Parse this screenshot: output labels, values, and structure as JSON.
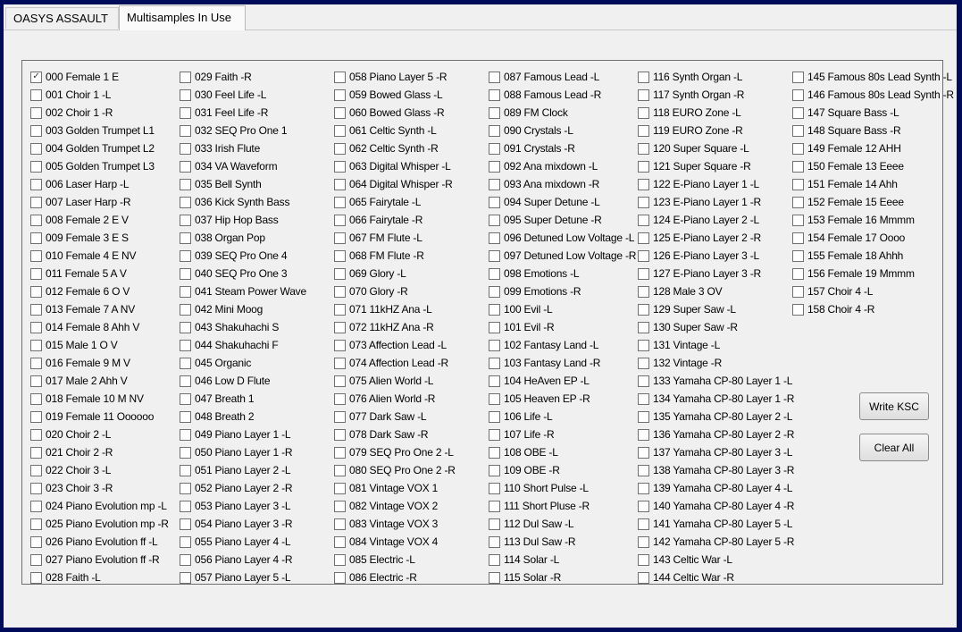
{
  "tabs": [
    "OASYS ASSAULT",
    "Multisamples In Use"
  ],
  "buttons": {
    "write": "Write KSC",
    "clear": "Clear All"
  },
  "columns": [
    [
      "000 Female 1 E",
      "001 Choir 1 -L",
      "002 Choir 1 -R",
      "003 Golden Trumpet L1",
      "004 Golden Trumpet L2",
      "005 Golden Trumpet L3",
      "006 Laser Harp -L",
      "007 Laser Harp -R",
      "008 Female 2 E V",
      "009 Female 3 E S",
      "010 Female 4 E NV",
      "011 Female 5 A V",
      "012 Female 6 O V",
      "013 Female 7 A NV",
      "014 Female 8 Ahh V",
      "015 Male 1 O V",
      "016 Female 9 M V",
      "017 Male 2 Ahh V",
      "018 Female 10 M NV",
      "019 Female 11 Oooooo",
      "020 Choir 2 -L",
      "021 Choir 2 -R",
      "022 Choir 3 -L",
      "023 Choir 3 -R",
      "024 Piano Evolution mp -L",
      "025 Piano Evolution mp -R",
      "026 Piano Evolution ff -L",
      "027 Piano Evolution ff -R",
      "028 Faith -L"
    ],
    [
      "029 Faith -R",
      "030 Feel Life -L",
      "031 Feel Life -R",
      "032 SEQ Pro One 1",
      "033 Irish Flute",
      "034 VA Waveform",
      "035 Bell Synth",
      "036 Kick Synth Bass",
      "037 Hip Hop Bass",
      "038 Organ Pop",
      "039 SEQ Pro One 4",
      "040 SEQ Pro One 3",
      "041 Steam Power Wave",
      "042 Mini Moog",
      "043 Shakuhachi S",
      "044 Shakuhachi F",
      "045 Organic",
      "046 Low D Flute",
      "047 Breath 1",
      "048 Breath 2",
      "049 Piano Layer 1 -L",
      "050 Piano Layer 1 -R",
      "051 Piano Layer 2 -L",
      "052 Piano Layer 2 -R",
      "053 Piano Layer 3 -L",
      "054 Piano Layer 3 -R",
      "055 Piano Layer 4 -L",
      "056 Piano Layer 4 -R",
      "057 Piano Layer 5 -L"
    ],
    [
      "058 Piano Layer 5 -R",
      "059 Bowed Glass -L",
      "060 Bowed Glass -R",
      "061 Celtic Synth -L",
      "062 Celtic Synth -R",
      "063 Digital Whisper -L",
      "064 Digital Whisper -R",
      "065 Fairytale -L",
      "066 Fairytale -R",
      "067 FM Flute -L",
      "068 FM Flute -R",
      "069 Glory -L",
      "070 Glory -R",
      "071 11kHZ Ana -L",
      "072 11kHZ Ana -R",
      "073 Affection Lead -L",
      "074 Affection Lead -R",
      "075 Alien World -L",
      "076 Alien World -R",
      "077 Dark Saw -L",
      "078 Dark Saw -R",
      "079 SEQ Pro One 2 -L",
      "080 SEQ Pro One 2 -R",
      "081 Vintage VOX 1",
      "082 Vintage VOX 2",
      "083 Vintage VOX 3",
      "084 Vintage VOX 4",
      "085 Electric -L",
      "086 Electric -R"
    ],
    [
      "087 Famous Lead -L",
      "088 Famous Lead -R",
      "089 FM Clock",
      "090 Crystals -L",
      "091 Crystals -R",
      "092 Ana mixdown -L",
      "093 Ana mixdown -R",
      "094 Super Detune -L",
      "095 Super Detune -R",
      "096 Detuned Low Voltage -L",
      "097 Detuned Low Voltage -R",
      "098 Emotions -L",
      "099 Emotions -R",
      "100 Evil -L",
      "101 Evil -R",
      "102 Fantasy Land -L",
      "103 Fantasy Land -R",
      "104 HeAven EP -L",
      "105 Heaven EP -R",
      "106 Life -L",
      "107 Life -R",
      "108 OBE -L",
      "109 OBE -R",
      "110 Short Pulse -L",
      "111 Short Pluse -R",
      "112 Dul Saw -L",
      "113 Dul Saw -R",
      "114 Solar -L",
      "115 Solar -R"
    ],
    [
      "116 Synth Organ -L",
      "117 Synth Organ -R",
      "118 EURO Zone -L",
      "119 EURO Zone -R",
      "120 Super Square -L",
      "121 Super Square -R",
      "122 E-Piano Layer 1 -L",
      "123 E-Piano Layer 1 -R",
      "124 E-Piano Layer 2 -L",
      "125 E-Piano Layer 2 -R",
      "126 E-Piano Layer 3 -L",
      "127 E-Piano Layer 3 -R",
      "128 Male 3 OV",
      "129 Super Saw -L",
      "130 Super Saw -R",
      "131 Vintage -L",
      "132 Vintage -R",
      "133 Yamaha CP-80 Layer 1 -L",
      "134 Yamaha CP-80 Layer 1 -R",
      "135 Yamaha CP-80 Layer 2 -L",
      "136 Yamaha CP-80 Layer 2 -R",
      "137 Yamaha CP-80 Layer 3 -L",
      "138 Yamaha CP-80 Layer 3 -R",
      "139 Yamaha CP-80 Layer 4 -L",
      "140 Yamaha CP-80 Layer 4 -R",
      "141 Yamaha CP-80 Layer 5 -L",
      "142 Yamaha CP-80 Layer 5 -R",
      "143 Celtic War -L",
      "144 Celtic War -R"
    ],
    [
      "145 Famous 80s Lead Synth -L",
      "146 Famous 80s Lead Synth -R",
      "147 Square Bass -L",
      "148 Square Bass -R",
      "149 Female 12 AHH",
      "150 Female 13 Eeee",
      "151 Female 14 Ahh",
      "152 Female 15 Eeee",
      "153 Female 16 Mmmm",
      "154 Female 17 Oooo",
      "155 Female 18 Ahhh",
      "156 Female 19 Mmmm",
      "157 Choir 4 -L",
      "158 Choir 4 -R"
    ]
  ],
  "checked": [
    "000 Female 1 E"
  ]
}
